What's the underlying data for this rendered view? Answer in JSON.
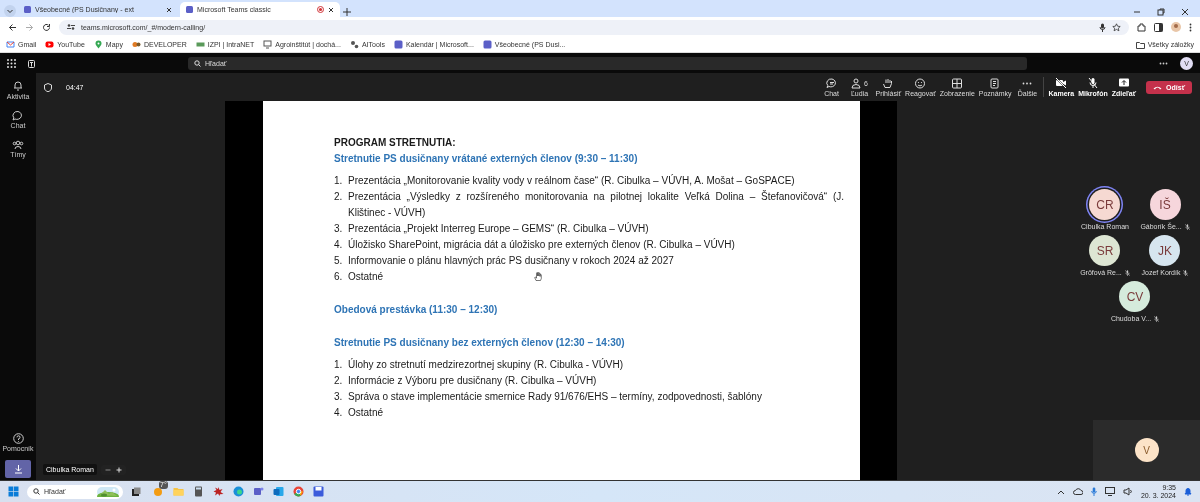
{
  "browser": {
    "tabs": [
      {
        "title": "Všeobecné (PS Dusičnany - ext",
        "selected": false
      },
      {
        "title": "Microsoft Teams classic",
        "selected": true,
        "recording": true
      }
    ],
    "address": "teams.microsoft.com/_#/modern-calling/",
    "bookmarks": [
      "Gmail",
      "YouTube",
      "Mapy",
      "DEVELOPER",
      "IZPI | IntraNET",
      "Agroinštitút | dochá...",
      "AITools",
      "Kalendár | Microsoft...",
      "Všeobecné (PS Dusi..."
    ],
    "all_bookmarks": "Všetky záložky"
  },
  "teams": {
    "search": {
      "placeholder": "Hľadať"
    },
    "user_initial": "V",
    "rail": [
      {
        "label": "Aktivita"
      },
      {
        "label": "Chat"
      },
      {
        "label": "Tímy"
      }
    ],
    "rail_bottom": {
      "label": "Pomocník"
    },
    "meeting": {
      "timer": "04:47",
      "toolbar": [
        {
          "label": "Chat"
        },
        {
          "label": "Ľudia",
          "count": "6"
        },
        {
          "label": "Prihlásiť"
        },
        {
          "label": "Reagovať"
        },
        {
          "label": "Zobrazenie"
        },
        {
          "label": "Poznámky"
        },
        {
          "label": "Ďalšie"
        }
      ],
      "controls": [
        {
          "label": "Kamera"
        },
        {
          "label": "Mikrofón"
        },
        {
          "label": "Zdieľať"
        }
      ],
      "leave": "Odísť",
      "presenter": "Cibulka Roman",
      "document": {
        "title": "PROGRAM STRETNUTIA:",
        "sections": [
          {
            "heading": "Stretnutie PS dusičnany vrátané externých členov (9:30 – 11:30)",
            "items": [
              {
                "number": "1.",
                "text": "Prezentácia „Monitorovanie kvality vody v reálnom čase“ (R. Cibulka – VÚVH, A. Mošat – GoSPACE)"
              },
              {
                "number": "2.",
                "text": "Prezentácia „Výsledky z rozšíreného monitorovania na pilotnej lokalite Veľká Dolina – Štefanovičová“ (J. Klištinec - VÚVH)"
              },
              {
                "number": "3.",
                "text": "Prezentácia „Projekt Interreg Europe – GEMS“ (R. Cibulka – VÚVH)"
              },
              {
                "number": "4.",
                "text": "Úložisko SharePoint, migrácia dát a úložisko pre externých členov (R. Cibulka – VÚVH)"
              },
              {
                "number": "5.",
                "text": "Informovanie o plánu hlavných prác PS dusičnany v rokoch 2024 až 2027"
              },
              {
                "number": "6.",
                "text": "Ostatné"
              }
            ]
          },
          {
            "heading": "Obedová prestávka (11:30 – 12:30)"
          },
          {
            "heading": "Stretnutie PS dusičnany bez externých členov (12:30 – 14:30)",
            "items": [
              {
                "number": "1.",
                "text": "Úlohy zo stretnutí medzirezortnej skupiny (R. Cibulka - VÚVH)"
              },
              {
                "number": "2.",
                "text": "Informácie z Výboru pre dusičnany (R. Cibulka – VÚVH)"
              },
              {
                "number": "3.",
                "text": "Správa o stave implementácie smernice Rady 91/676/EHS – termíny, zodpovednosti, šablóny"
              },
              {
                "number": "4.",
                "text": "Ostatné"
              }
            ]
          }
        ]
      },
      "participants": [
        {
          "initials": "CR",
          "name": "Cibulka Roman",
          "color": "#f6d9d2",
          "muted": false,
          "speaking": true
        },
        {
          "initials": "IŠ",
          "name": "Gáborík Še...",
          "color": "#f6d6dc",
          "muted": true,
          "speaking": false
        },
        {
          "initials": "SR",
          "name": "Gröfová Re...",
          "color": "#dde6d3",
          "muted": true,
          "speaking": false
        },
        {
          "initials": "JK",
          "name": "Jozef Kordík",
          "color": "#d6e5ef",
          "muted": true,
          "speaking": false
        },
        {
          "initials": "CV",
          "name": "Chudoba V...",
          "color": "#d5ebdc",
          "muted": true,
          "speaking": false
        }
      ],
      "self_tile": {
        "initial": "V"
      }
    }
  },
  "taskbar": {
    "search": {
      "placeholder": "Hľadať"
    },
    "weather_badge": "7°",
    "time": "9:35",
    "date": "20. 3. 2024"
  }
}
